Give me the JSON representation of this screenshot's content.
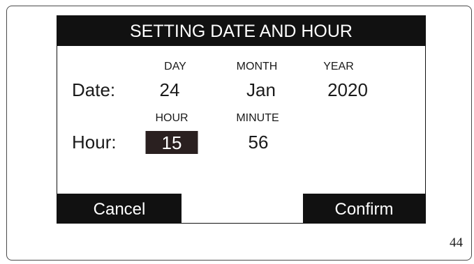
{
  "page": {
    "number": "44"
  },
  "screen": {
    "title": "SETTING DATE AND HOUR",
    "date_row": {
      "label": "Date:",
      "day": {
        "label": "DAY",
        "value": "24"
      },
      "month": {
        "label": "MONTH",
        "value": "Jan"
      },
      "year": {
        "label": "YEAR",
        "value": "2020"
      }
    },
    "hour_row": {
      "label": "Hour:",
      "hour": {
        "label": "HOUR",
        "value": "15"
      },
      "minute": {
        "label": "MINUTE",
        "value": "56"
      }
    },
    "buttons": {
      "cancel": "Cancel",
      "confirm": "Confirm"
    }
  },
  "colors": {
    "bar_background": "#111111",
    "selected_field": "#2a2020",
    "text": "#1a1a1a"
  }
}
